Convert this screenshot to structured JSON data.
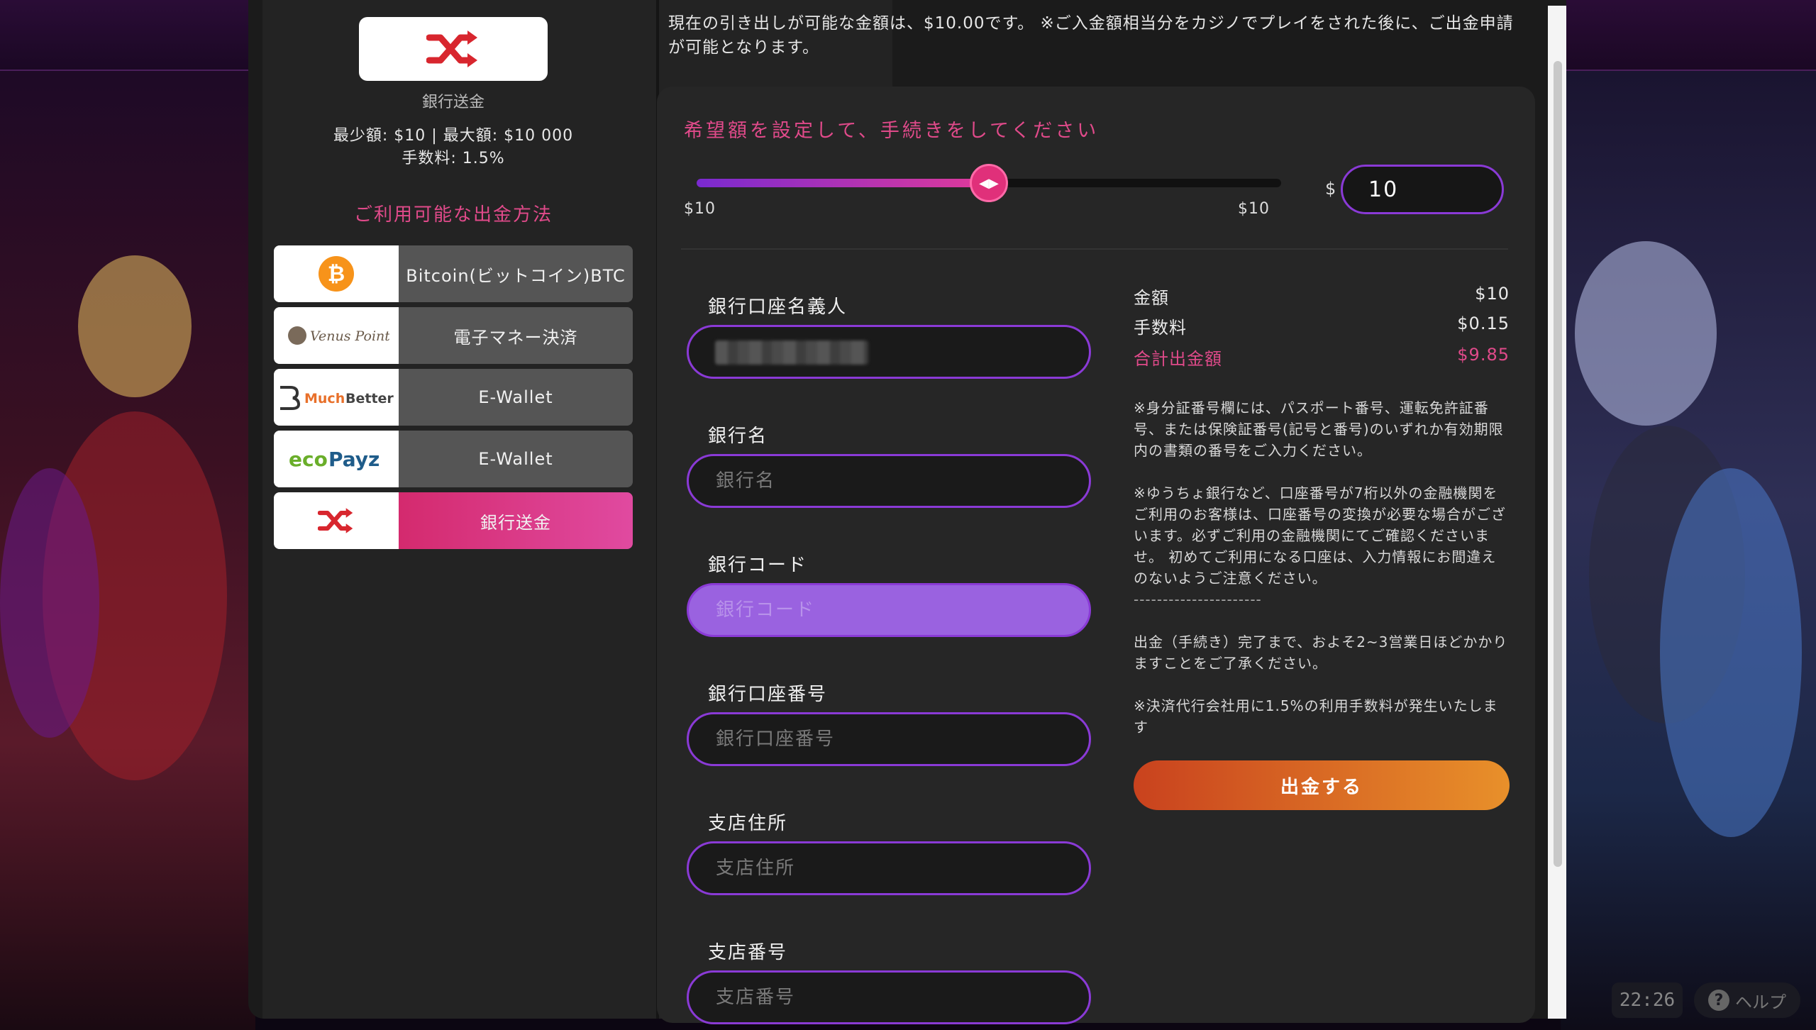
{
  "background": {
    "clock": "22:26",
    "help_label": "ヘルプ"
  },
  "selected_method": {
    "icon": "shuffle-icon",
    "name": "銀行送金",
    "limits_line": "最少額: $10 | 最大額: $10 000",
    "fee_line": "手数料: 1.5%"
  },
  "methods_title": "ご利用可能な出金方法",
  "methods": [
    {
      "logo": "Bitcoin",
      "label": "Bitcoin(ビットコイン)BTC"
    },
    {
      "logo": "Venus Point",
      "label": "電子マネー決済"
    },
    {
      "logo": "MuchBetter",
      "label": "E-Wallet"
    },
    {
      "logo": "ecoPayz",
      "label": "E-Wallet"
    },
    {
      "logo": "shuffle-icon",
      "label": "銀行送金"
    }
  ],
  "info_text": "現在の引き出しが可能な金額は、$10.00です。 ※ご入金額相当分をカジノでプレイをされた後に、ご出金申請が可能となります。",
  "amount_panel": {
    "title": "希望額を設定して、手続きをしてください",
    "slider_min_label": "$10",
    "slider_max_label": "$10",
    "slider_position": 0.5,
    "currency": "$",
    "amount_value": "10"
  },
  "form": {
    "account_holder": {
      "label": "銀行口座名義人",
      "placeholder": ""
    },
    "bank_name": {
      "label": "銀行名",
      "placeholder": "銀行名"
    },
    "bank_code": {
      "label": "銀行コード",
      "placeholder": "銀行コード"
    },
    "account_number": {
      "label": "銀行口座番号",
      "placeholder": "銀行口座番号"
    },
    "branch_address": {
      "label": "支店住所",
      "placeholder": "支店住所"
    },
    "branch_number": {
      "label": "支店番号",
      "placeholder": "支店番号"
    }
  },
  "summary": {
    "amount_label": "金額",
    "amount_value": "$10",
    "fee_label": "手数料",
    "fee_value": "$0.15",
    "total_label": "合計出金額",
    "total_value": "$9.85"
  },
  "notes": {
    "note1": "※身分証番号欄には、パスポート番号、運転免許証番号、または保険証番号(記号と番号)のいずれか有効期限内の書類の番号をご入力ください。",
    "note2": "※ゆうちょ銀行など、口座番号が7桁以外の金融機関をご利用のお客様は、口座番号の変換が必要な場合がございます。必ずご利用の金融機関にてご確認くださいませ。 初めてご利用になる口座は、入力情報にお間違えのないようご注意ください。",
    "dash": "----------------------",
    "note3": "出金（手続き）完了まで、およそ2~3営業日ほどかかりますことをご了承ください。",
    "note4": "※決済代行会社用に1.5%の利用手数料が発生いたします"
  },
  "withdraw_button": "出金する",
  "colors": {
    "accent_pink": "#e04a8a",
    "accent_purple": "#8a3ad6",
    "button_orange": "#e8902a"
  }
}
